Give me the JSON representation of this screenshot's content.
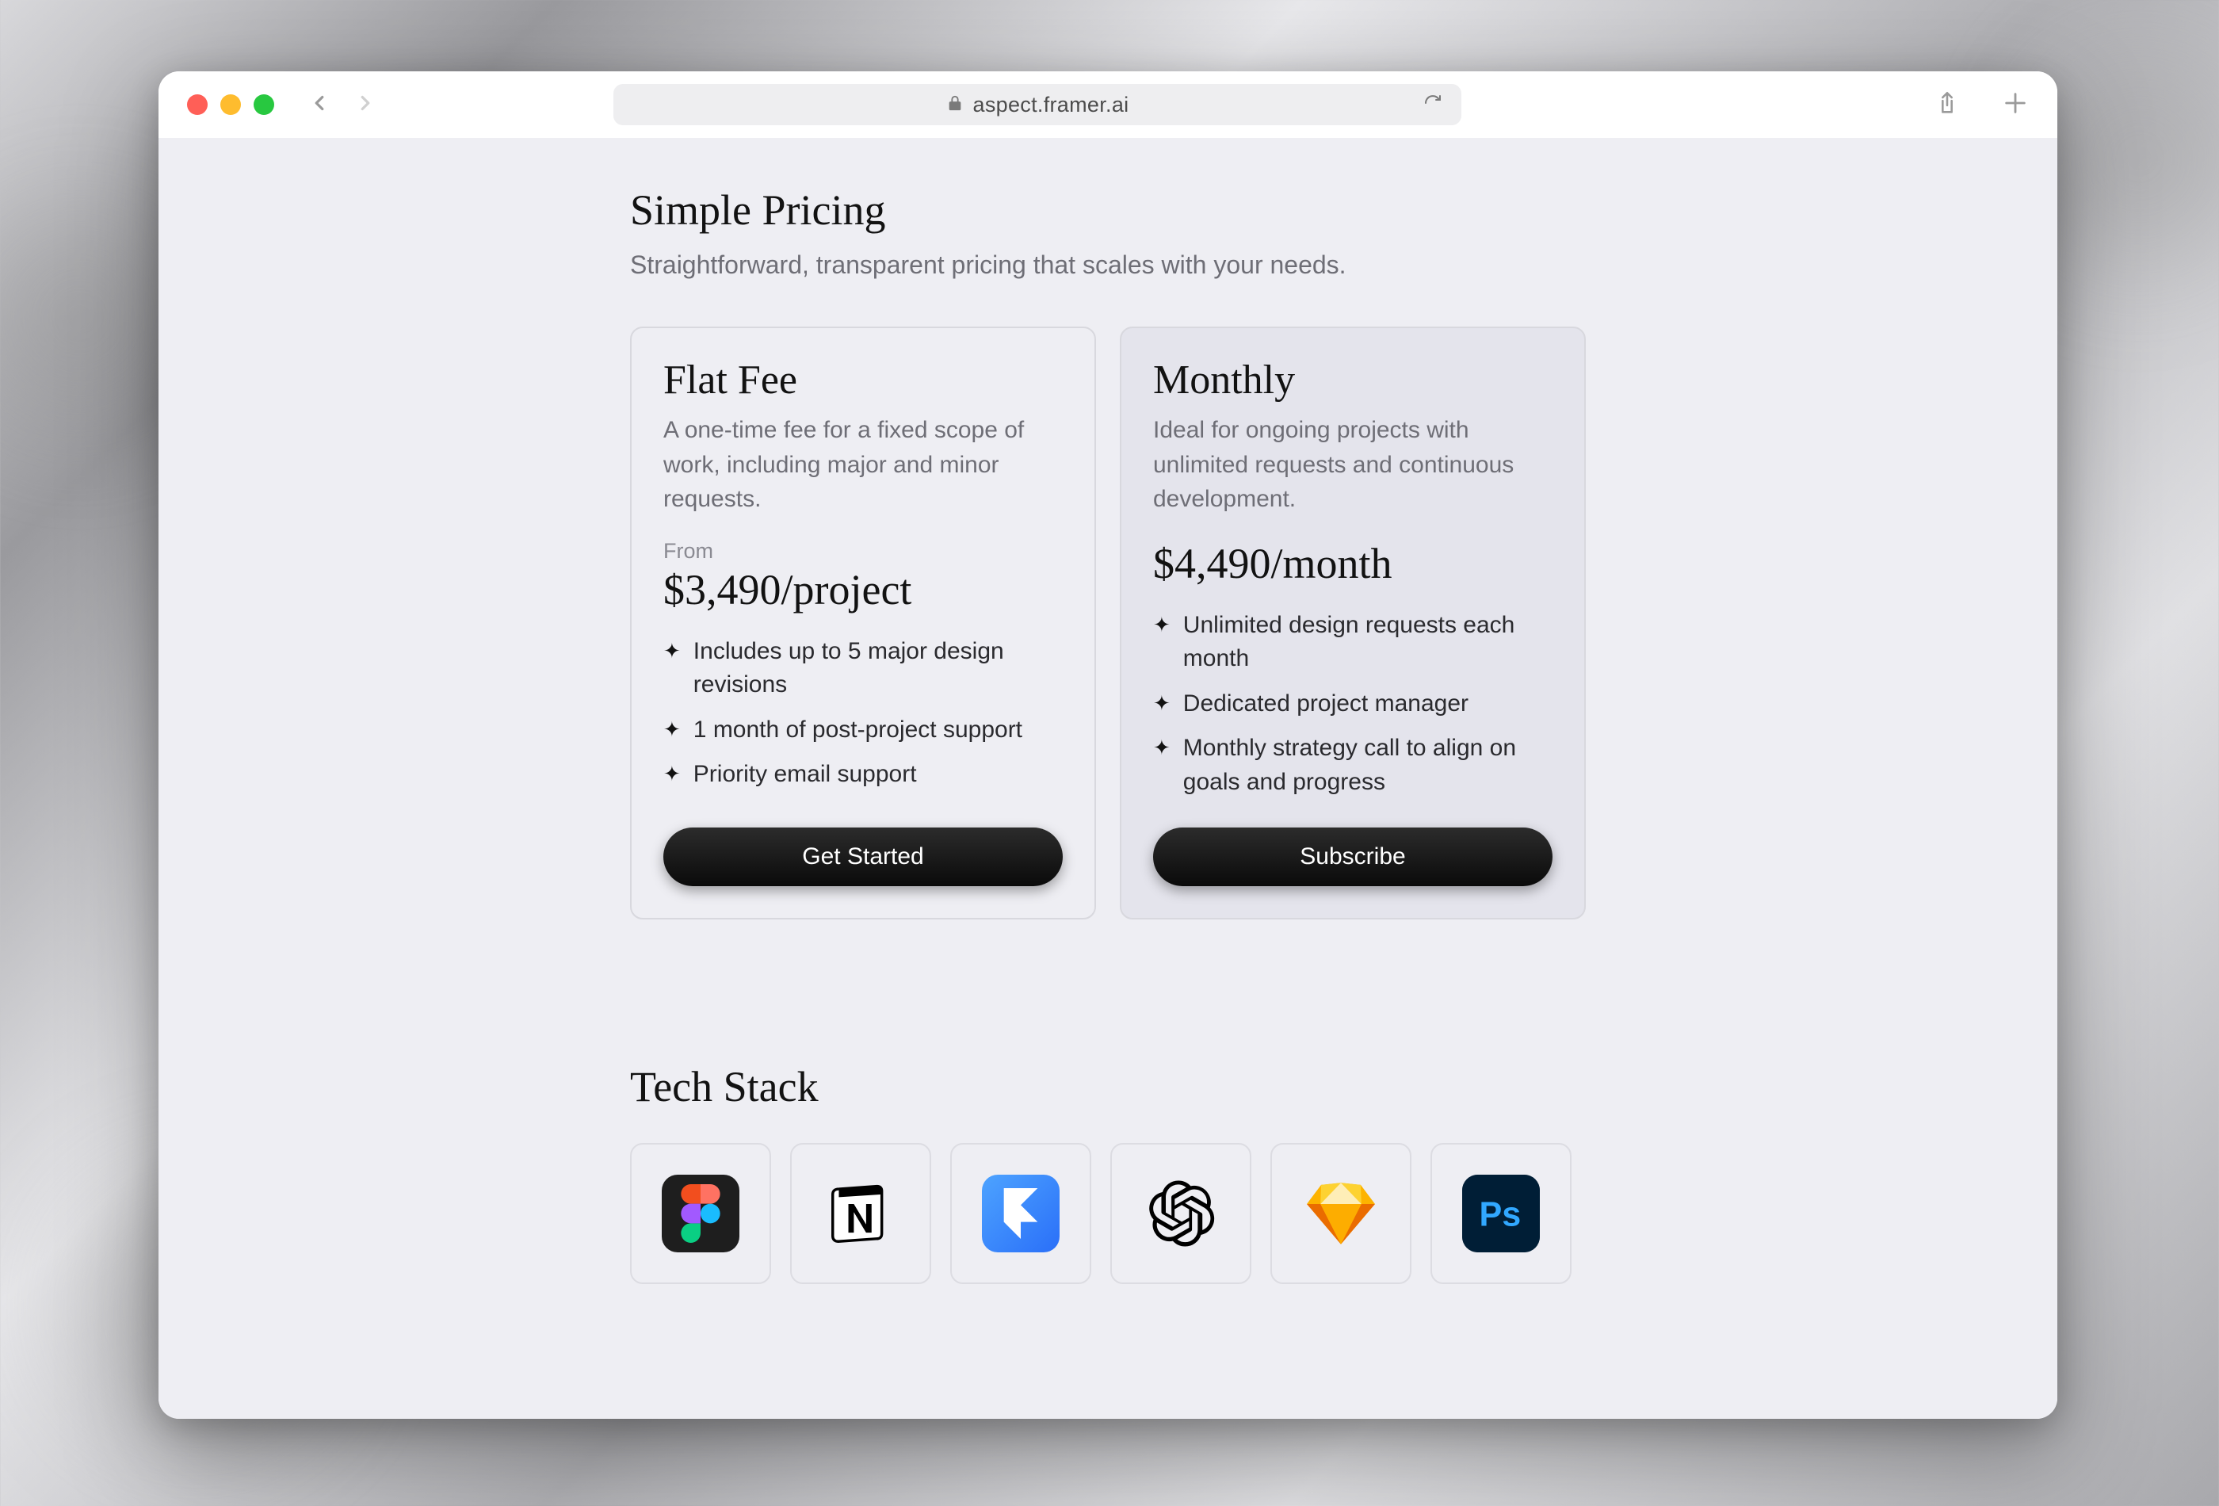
{
  "browser": {
    "url": "aspect.framer.ai"
  },
  "pricing": {
    "title": "Simple Pricing",
    "subtitle": "Straightforward, transparent pricing that scales with your needs.",
    "plans": [
      {
        "name": "Flat Fee",
        "description": "A one-time fee for a fixed scope of work, including major and minor requests.",
        "from_label": "From",
        "price": "$3,490/project",
        "features": [
          "Includes up to 5 major design revisions",
          "1 month of post-project support",
          "Priority email support"
        ],
        "cta": "Get Started"
      },
      {
        "name": "Monthly",
        "description": "Ideal for ongoing projects with unlimited requests and continuous development.",
        "from_label": "",
        "price": "$4,490/month",
        "features": [
          "Unlimited design requests each month",
          "Dedicated project manager",
          "Monthly strategy call to align on goals and progress"
        ],
        "cta": "Subscribe"
      }
    ]
  },
  "tech_stack": {
    "title": "Tech Stack",
    "items": [
      "figma",
      "notion",
      "framer",
      "openai",
      "sketch",
      "photoshop"
    ]
  }
}
